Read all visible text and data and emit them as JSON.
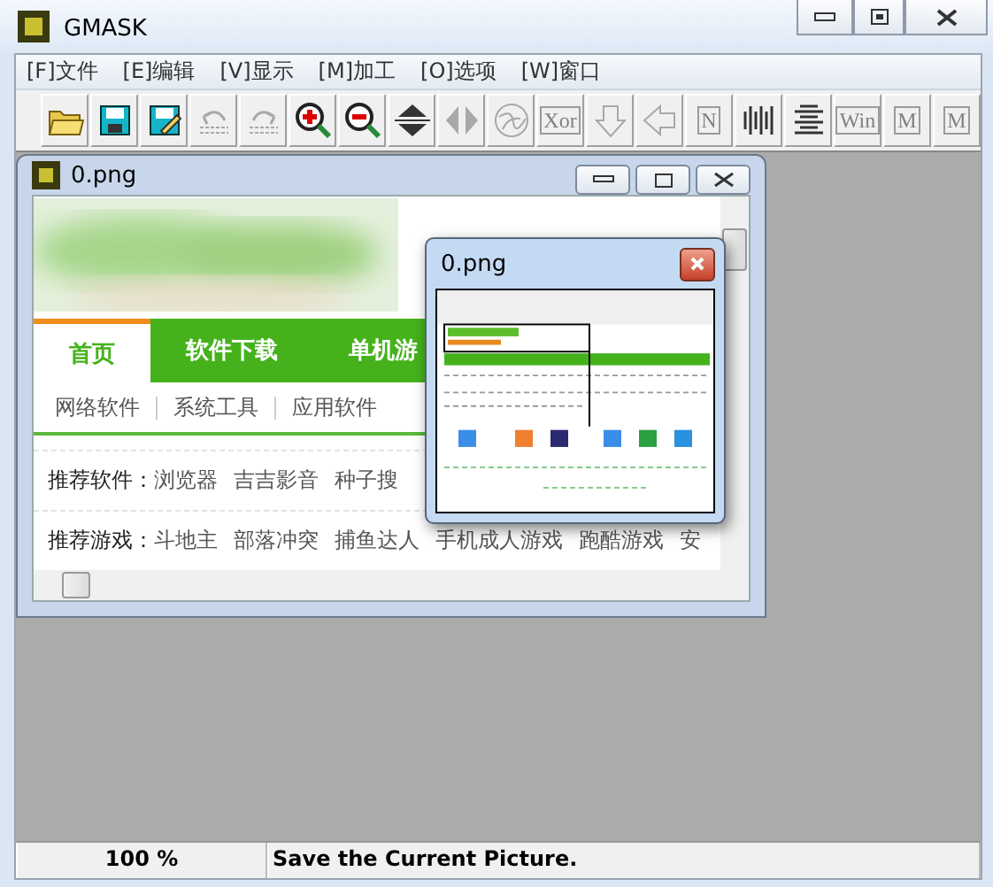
{
  "window": {
    "title": "GMASK"
  },
  "menu": [
    "[F]文件",
    "[E]编辑",
    "[V]显示",
    "[M]加工",
    "[O]选项",
    "[W]窗口"
  ],
  "toolbar": [
    {
      "kind": "open",
      "disabled": false
    },
    {
      "kind": "save",
      "disabled": false
    },
    {
      "kind": "saveas",
      "disabled": false
    },
    {
      "kind": "undo",
      "disabled": true
    },
    {
      "kind": "redo",
      "disabled": true
    },
    {
      "kind": "zoom-in",
      "disabled": false
    },
    {
      "kind": "zoom-out",
      "disabled": false
    },
    {
      "kind": "flip-v",
      "disabled": false
    },
    {
      "kind": "flip-h",
      "disabled": true
    },
    {
      "kind": "swirl",
      "disabled": true
    },
    {
      "kind": "letter",
      "glyph": "Xor",
      "disabled": true
    },
    {
      "kind": "arrow-down",
      "disabled": true
    },
    {
      "kind": "arrow-left",
      "disabled": true
    },
    {
      "kind": "letter",
      "glyph": "N",
      "disabled": true
    },
    {
      "kind": "bars-v",
      "disabled": false
    },
    {
      "kind": "bars-h",
      "disabled": false
    },
    {
      "kind": "letter",
      "glyph": "Win",
      "disabled": true
    },
    {
      "kind": "letter",
      "glyph": "M",
      "disabled": true
    },
    {
      "kind": "letter",
      "glyph": "M",
      "disabled": true
    }
  ],
  "child_window": {
    "title": "0.png",
    "page": {
      "nav": [
        {
          "label": "首页",
          "selected": true
        },
        {
          "label": "软件下载",
          "selected": false
        },
        {
          "label": "单机游",
          "selected": false
        }
      ],
      "subnav": [
        "网络软件",
        "系统工具",
        "应用软件"
      ],
      "rows": [
        {
          "label": "推荐软件：",
          "links": [
            "浏览器",
            "吉吉影音",
            "种子搜"
          ]
        },
        {
          "label": "推荐游戏：",
          "links": [
            "斗地主",
            "部落冲突",
            "捕鱼达人",
            "手机成人游戏",
            "跑酷游戏",
            "安"
          ]
        }
      ]
    }
  },
  "navigator": {
    "title": "0.png"
  },
  "status_bar": {
    "zoom": "100 %",
    "message": "Save the Current Picture."
  }
}
